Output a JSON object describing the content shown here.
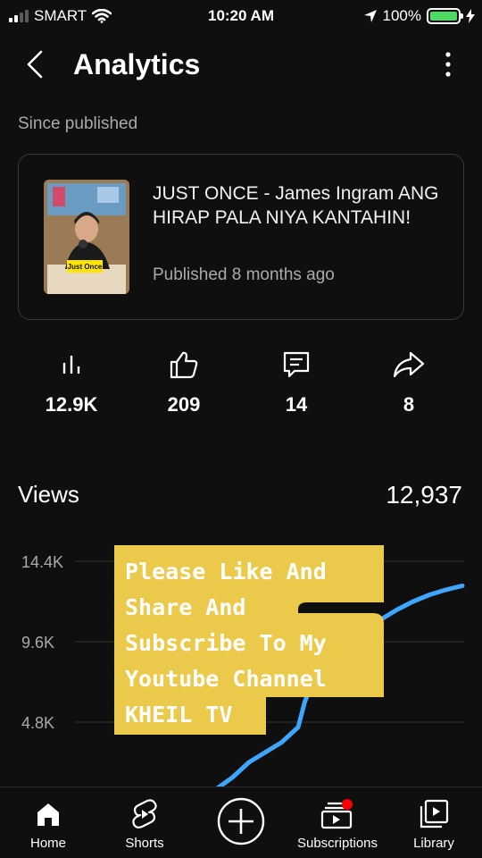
{
  "status_bar": {
    "carrier": "SMART",
    "time": "10:20 AM",
    "battery": "100%"
  },
  "header": {
    "title": "Analytics"
  },
  "since_label": "Since published",
  "video": {
    "title": "JUST ONCE - James Ingram ANG HIRAP PALA NIYA KANTAHIN!",
    "published": "Published 8 months ago",
    "thumb_text": "Just Once"
  },
  "stats": [
    {
      "icon": "views-bar-icon",
      "value": "12.9K"
    },
    {
      "icon": "like-icon",
      "value": "209"
    },
    {
      "icon": "comment-icon",
      "value": "14"
    },
    {
      "icon": "share-icon",
      "value": "8"
    }
  ],
  "views": {
    "label": "Views",
    "total": "12,937"
  },
  "chart_data": {
    "type": "line",
    "color": "#3ea6ff",
    "y_ticks": [
      "14.4K",
      "9.6K",
      "4.8K"
    ],
    "ylim": [
      0,
      14400
    ],
    "x": [
      0,
      0.05,
      0.1,
      0.15,
      0.2,
      0.25,
      0.3,
      0.35,
      0.4,
      0.45,
      0.5,
      0.52,
      0.55,
      0.6,
      0.65,
      0.7,
      0.75,
      0.8,
      0.85,
      0.9,
      0.95,
      1.0
    ],
    "values": [
      0,
      110,
      300,
      450,
      580,
      800,
      1500,
      2400,
      3000,
      3600,
      4500,
      6000,
      7500,
      8700,
      9600,
      10200,
      10900,
      11500,
      12000,
      12400,
      12700,
      12937
    ]
  },
  "overlay": {
    "lines": [
      "Please Like And",
      "Share And",
      "Subscribe To My",
      "Youtube Channel",
      "KHEIL TV"
    ],
    "bg": "#ebc94a"
  },
  "tabs": [
    {
      "label": "Home",
      "icon": "home-icon"
    },
    {
      "label": "Shorts",
      "icon": "shorts-icon"
    },
    {
      "label": "",
      "icon": "create-plus-icon"
    },
    {
      "label": "Subscriptions",
      "icon": "subscriptions-icon"
    },
    {
      "label": "Library",
      "icon": "library-icon"
    }
  ]
}
